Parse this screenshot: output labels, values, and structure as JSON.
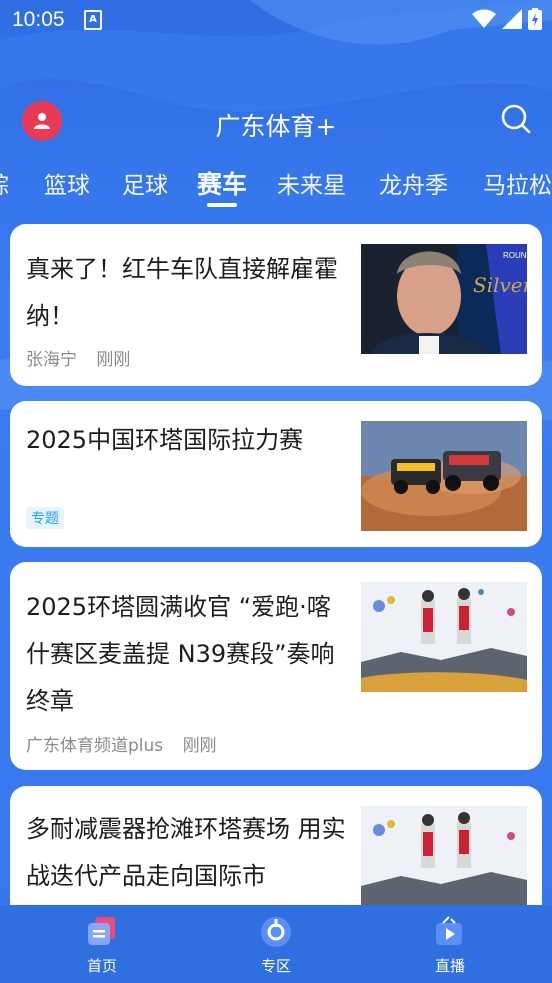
{
  "status_bar": {
    "time": "10:05",
    "notif_icon_letter": "A"
  },
  "header": {
    "title": "广东体育+"
  },
  "tabs": [
    {
      "label": "综",
      "active": false
    },
    {
      "label": "篮球",
      "active": false
    },
    {
      "label": "足球",
      "active": false
    },
    {
      "label": "赛车",
      "active": true
    },
    {
      "label": "未来星",
      "active": false
    },
    {
      "label": "龙舟季",
      "active": false
    },
    {
      "label": "马拉松",
      "active": false
    }
  ],
  "cards": [
    {
      "title": "真来了！红牛车队直接解雇霍纳！",
      "author": "张海宁",
      "time": "刚刚",
      "thumb": "man-portrait"
    },
    {
      "title": "2025中国环塔国际拉力赛",
      "badge": "专题",
      "thumb": "desert-rally"
    },
    {
      "title": "2025环塔圆满收官 “爱跑·喀什赛区麦盖提 N39赛段”奏响终章",
      "author": "广东体育频道plus",
      "time": "刚刚",
      "thumb": "podium-celebration"
    },
    {
      "title": "多耐减震器抢滩环塔赛场 用实战迭代产品走向国际市",
      "thumb": "podium-celebration"
    }
  ],
  "bottom_nav": [
    {
      "label": "首页",
      "icon": "home-icon"
    },
    {
      "label": "专区",
      "icon": "zone-icon"
    },
    {
      "label": "直播",
      "icon": "live-icon"
    }
  ],
  "colors": {
    "primary": "#2f6fe0",
    "avatar": "#ea3b56",
    "badge": "#26a0e3"
  }
}
